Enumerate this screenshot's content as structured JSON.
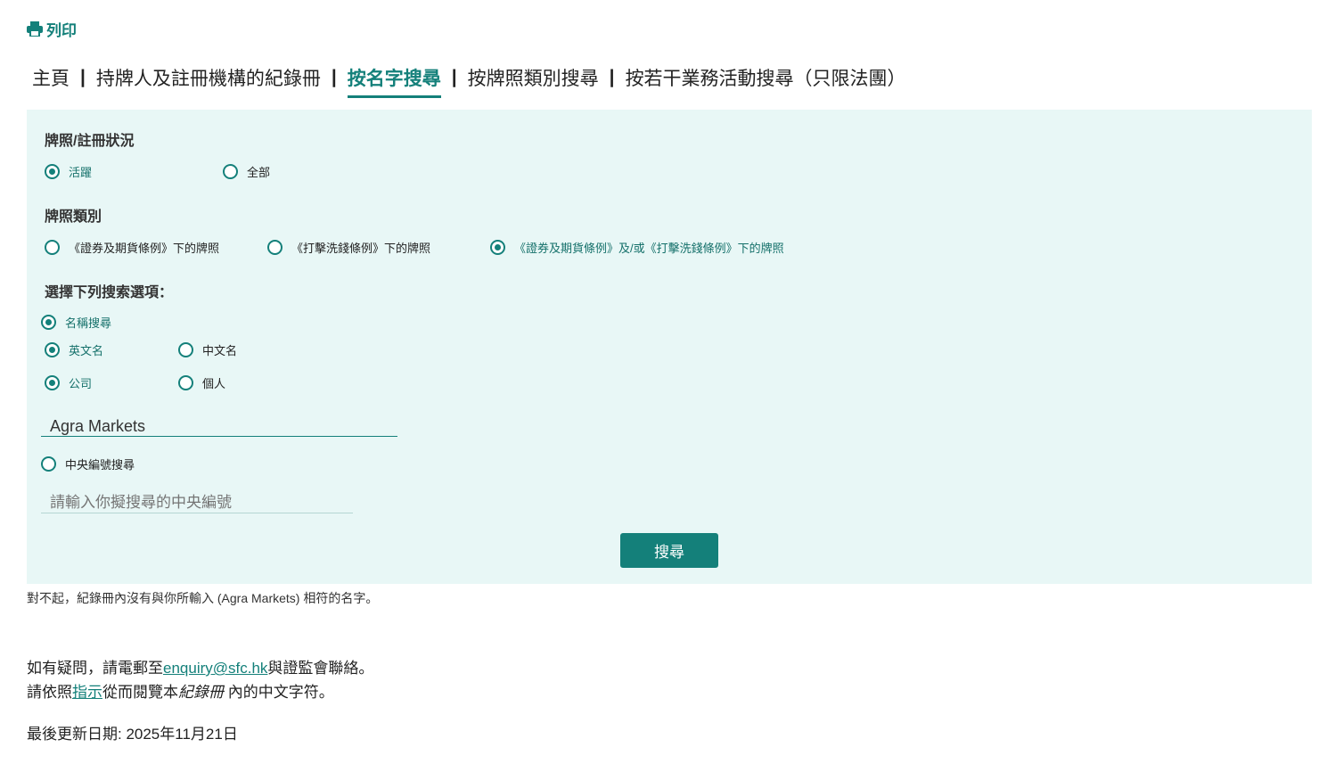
{
  "print_label": "列印",
  "nav": {
    "items": [
      "主頁",
      "持牌人及註冊機構的紀錄冊",
      "按名字搜尋",
      "按牌照類別搜尋",
      "按若干業務活動搜尋（只限法團）"
    ],
    "active": 2
  },
  "form": {
    "status_heading": "牌照/註冊狀況",
    "status_options": [
      "活躍",
      "全部"
    ],
    "type_heading": "牌照類別",
    "type_options": [
      "《證券及期貨條例》下的牌照",
      "《打擊洗錢條例》下的牌照",
      "《證券及期貨條例》及/或《打擊洗錢條例》下的牌照"
    ],
    "search_heading": "選擇下列搜索選項：",
    "name_search": "名稱搜尋",
    "english_name": "英文名",
    "chinese_name": "中文名",
    "company": "公司",
    "individual": "個人",
    "name_value": "Agra Markets",
    "ce_search": "中央編號搜尋",
    "ce_placeholder": "請輸入你擬搜尋的中央編號",
    "submit": "搜尋"
  },
  "message": "對不起，紀錄冊內沒有與你所輸入 (Agra Markets) 相符的名字。",
  "footer": {
    "l1a": "如有疑問，請電郵至",
    "email": "enquiry@sfc.hk",
    "l1b": "與證監會聯絡。",
    "l2a": "請依照",
    "guide": "指示",
    "l2b": "從而閱覽本",
    "l2i": "紀錄冊",
    "l2c": " 內的中文字符。",
    "updated": "最後更新日期: 2025年11月21日"
  },
  "colors": {
    "accent": "#14807a",
    "panel": "#e8f7f6"
  }
}
